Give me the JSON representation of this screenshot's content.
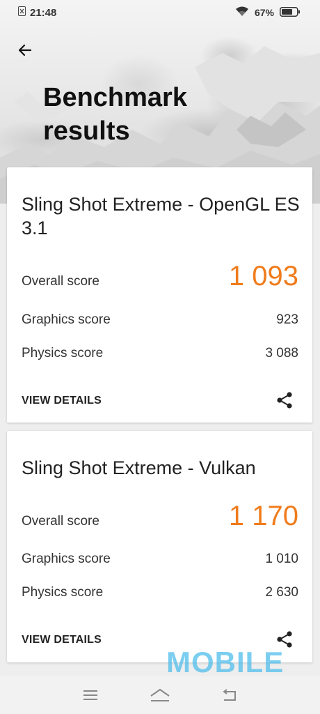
{
  "status_bar": {
    "time": "21:48",
    "battery_percent": "67%"
  },
  "header": {
    "title": "Benchmark results"
  },
  "cards": [
    {
      "title": "Sling Shot Extreme - OpenGL ES 3.1",
      "overall_label": "Overall score",
      "overall_value": "1 093",
      "graphics_label": "Graphics score",
      "graphics_value": "923",
      "physics_label": "Physics score",
      "physics_value": "3 088",
      "details_label": "VIEW DETAILS"
    },
    {
      "title": "Sling Shot Extreme - Vulkan",
      "overall_label": "Overall score",
      "overall_value": "1 170",
      "graphics_label": "Graphics score",
      "graphics_value": "1 010",
      "physics_label": "Physics score",
      "physics_value": "2 630",
      "details_label": "VIEW DETAILS"
    }
  ],
  "watermark": "MOBILE",
  "colors": {
    "accent": "#f07c1c",
    "watermark": "#50bee b"
  },
  "icons": [
    "sim-icon",
    "wifi-icon",
    "battery-icon",
    "back-arrow-icon",
    "share-icon",
    "menu-icon",
    "home-icon",
    "recents-icon"
  ]
}
